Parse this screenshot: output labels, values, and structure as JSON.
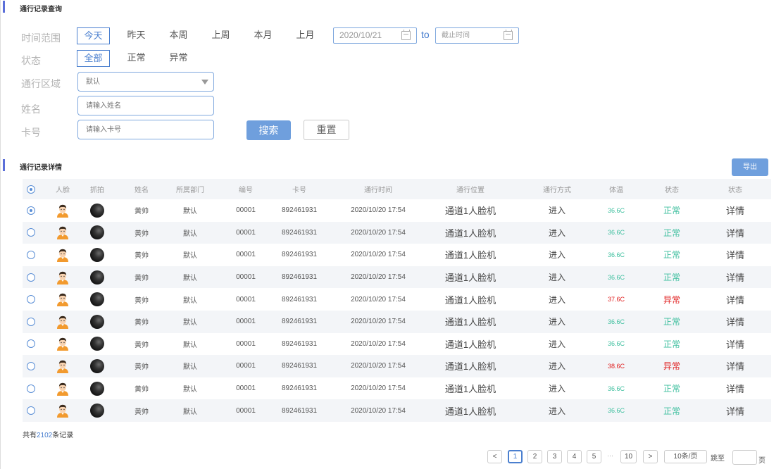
{
  "query_section": {
    "title": "通行记录查询"
  },
  "filters": {
    "time_range": {
      "label": "时间范围",
      "options": [
        "今天",
        "昨天",
        "本周",
        "上周",
        "本月",
        "上月"
      ],
      "selected": "今天"
    },
    "start_date": "2020/10/21",
    "to_label": "to",
    "end_date_placeholder": "截止时间",
    "status": {
      "label": "状态",
      "options": [
        "全部",
        "正常",
        "异常"
      ],
      "selected": "全部"
    },
    "area": {
      "label": "通行区域",
      "value": "默认"
    },
    "name": {
      "label": "姓名",
      "placeholder": "请输入姓名"
    },
    "card": {
      "label": "卡号",
      "placeholder": "请输入卡号"
    },
    "search_label": "搜索",
    "reset_label": "重置"
  },
  "detail_section": {
    "title": "通行记录详情",
    "export_label": "导出"
  },
  "table": {
    "columns": [
      "人脸",
      "抓拍",
      "姓名",
      "所属部门",
      "编号",
      "卡号",
      "通行时间",
      "通行位置",
      "通行方式",
      "体温",
      "状态",
      "状态"
    ],
    "rows": [
      {
        "name": "黄帅",
        "dept": "默认",
        "no": "00001",
        "card": "892461931",
        "time": "2020/10/20 17:54",
        "location": "通道1人脸机",
        "mode": "进入",
        "temp": "36.6C",
        "status": "正常",
        "detail": "详情",
        "selected": true
      },
      {
        "name": "黄帅",
        "dept": "默认",
        "no": "00001",
        "card": "892461931",
        "time": "2020/10/20 17:54",
        "location": "通道1人脸机",
        "mode": "进入",
        "temp": "36.6C",
        "status": "正常",
        "detail": "详情",
        "selected": false
      },
      {
        "name": "黄帅",
        "dept": "默认",
        "no": "00001",
        "card": "892461931",
        "time": "2020/10/20 17:54",
        "location": "通道1人脸机",
        "mode": "进入",
        "temp": "36.6C",
        "status": "正常",
        "detail": "详情",
        "selected": false
      },
      {
        "name": "黄帅",
        "dept": "默认",
        "no": "00001",
        "card": "892461931",
        "time": "2020/10/20 17:54",
        "location": "通道1人脸机",
        "mode": "进入",
        "temp": "36.6C",
        "status": "正常",
        "detail": "详情",
        "selected": false
      },
      {
        "name": "黄帅",
        "dept": "默认",
        "no": "00001",
        "card": "892461931",
        "time": "2020/10/20 17:54",
        "location": "通道1人脸机",
        "mode": "进入",
        "temp": "37.6C",
        "status": "异常",
        "detail": "详情",
        "selected": false
      },
      {
        "name": "黄帅",
        "dept": "默认",
        "no": "00001",
        "card": "892461931",
        "time": "2020/10/20 17:54",
        "location": "通道1人脸机",
        "mode": "进入",
        "temp": "36.6C",
        "status": "正常",
        "detail": "详情",
        "selected": false
      },
      {
        "name": "黄帅",
        "dept": "默认",
        "no": "00001",
        "card": "892461931",
        "time": "2020/10/20 17:54",
        "location": "通道1人脸机",
        "mode": "进入",
        "temp": "36.6C",
        "status": "正常",
        "detail": "详情",
        "selected": false
      },
      {
        "name": "黄帅",
        "dept": "默认",
        "no": "00001",
        "card": "892461931",
        "time": "2020/10/20 17:54",
        "location": "通道1人脸机",
        "mode": "进入",
        "temp": "38.6C",
        "status": "异常",
        "detail": "详情",
        "selected": false
      },
      {
        "name": "黄帅",
        "dept": "默认",
        "no": "00001",
        "card": "892461931",
        "time": "2020/10/20 17:54",
        "location": "通道1人脸机",
        "mode": "进入",
        "temp": "36.6C",
        "status": "正常",
        "detail": "详情",
        "selected": false
      },
      {
        "name": "黄帅",
        "dept": "默认",
        "no": "00001",
        "card": "892461931",
        "time": "2020/10/20 17:54",
        "location": "通道1人脸机",
        "mode": "进入",
        "temp": "36.6C",
        "status": "正常",
        "detail": "详情",
        "selected": false
      }
    ]
  },
  "summary": {
    "prefix": "共有",
    "count": "2102",
    "suffix": "条记录"
  },
  "pagination": {
    "prev": "<",
    "pages": [
      "1",
      "2",
      "3",
      "4",
      "5"
    ],
    "ellipsis": "···",
    "last": "10",
    "next": ">",
    "page_size": "10条/页",
    "jump_label": "跳至",
    "page_unit": "页",
    "current": "1"
  },
  "colors": {
    "accent": "#4a7fcf",
    "normal": "#3dbf9e",
    "abnormal": "#e02020",
    "temp_normal": "#3dbf9e",
    "temp_abnormal": "#e02020",
    "row_alt": "#f3f5f8"
  }
}
